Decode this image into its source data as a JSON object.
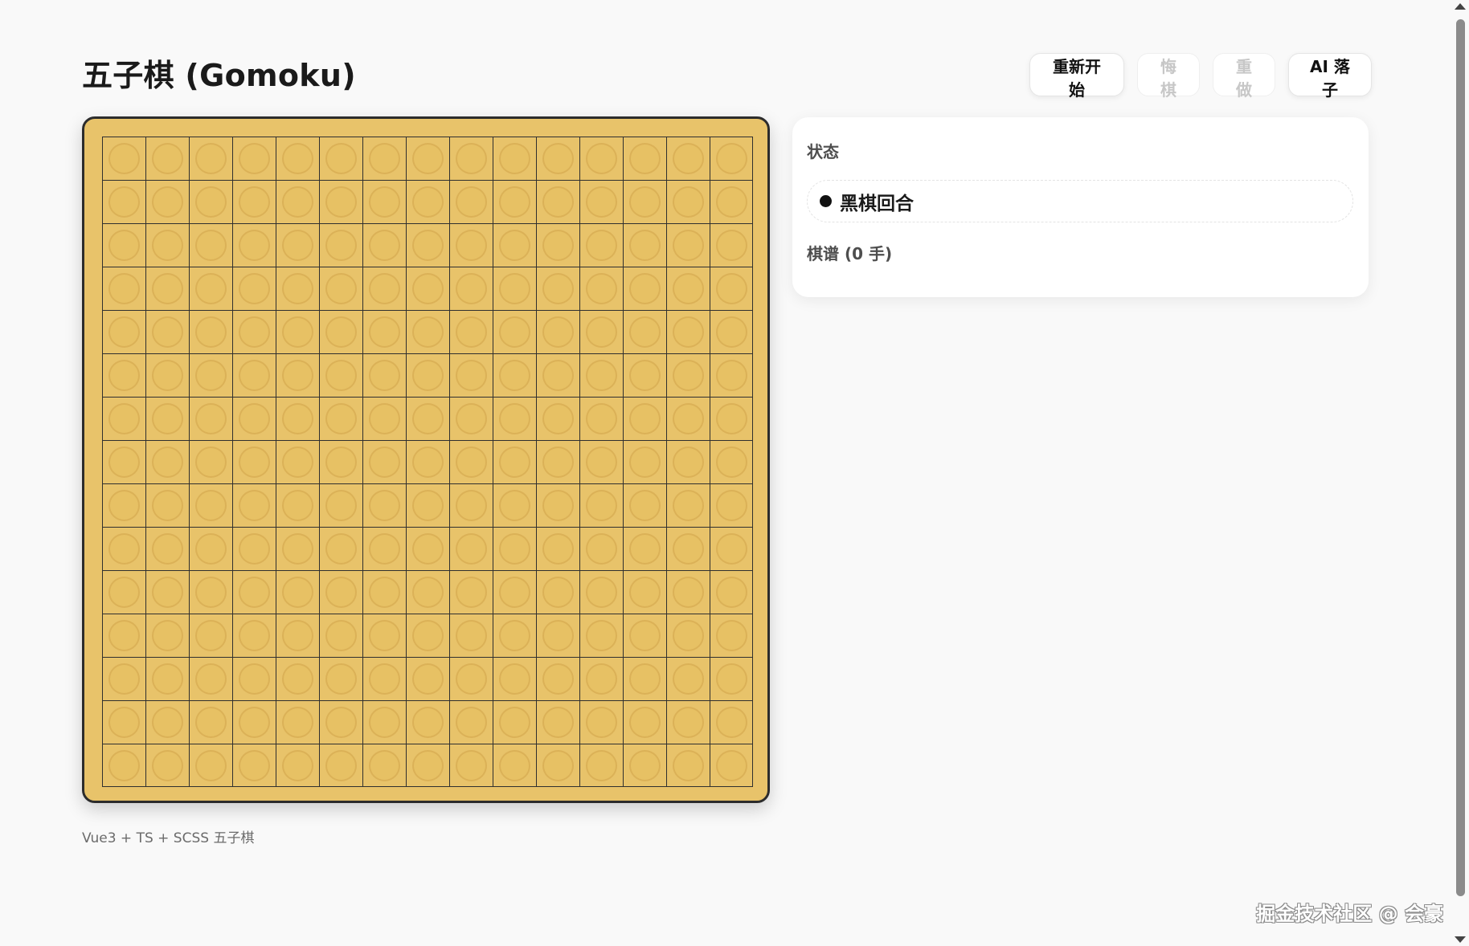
{
  "header": {
    "title": "五子棋 (Gomoku)"
  },
  "toolbar": {
    "restart_label": "重新开始",
    "undo_label": "悔棋",
    "redo_label": "重做",
    "ai_label": "AI 落子"
  },
  "board": {
    "rows": 15,
    "cols": 15,
    "stones": []
  },
  "panel": {
    "status_title": "状态",
    "status_text": "黑棋回合",
    "record_title": "棋谱 (0 手)"
  },
  "footer": {
    "text": "Vue3 + TS + SCSS 五子棋"
  },
  "watermark": {
    "text": "掘金技术社区 @ 会豪"
  },
  "colors": {
    "board": "#e8c36a",
    "grid": "#2f2f2f",
    "background": "#f9f9f9"
  }
}
